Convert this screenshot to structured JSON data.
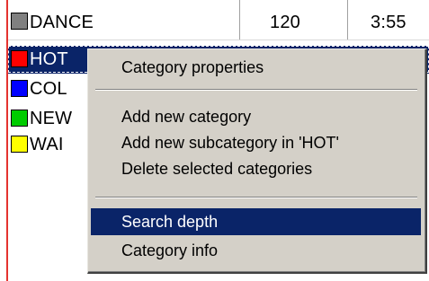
{
  "grid": {
    "rows": [
      {
        "swatch_color": "#808080",
        "name": "DANCE",
        "bpm": "120",
        "length": "3:55"
      },
      {
        "swatch_color": "#ff0000",
        "name": "HOT"
      },
      {
        "swatch_color": "#0000ff",
        "name": "COL"
      },
      {
        "swatch_color": "#00cc00",
        "name": "NEW"
      },
      {
        "swatch_color": "#ffff00",
        "name": "WAI"
      }
    ],
    "selected_index": 1
  },
  "context_menu": {
    "items": [
      {
        "label": "Category properties"
      },
      {
        "label": "Add new category"
      },
      {
        "label": "Add new subcategory in 'HOT'"
      },
      {
        "label": "Delete selected categories"
      },
      {
        "label": "Search depth"
      },
      {
        "label": "Category info"
      }
    ],
    "highlighted_label": "Search depth"
  }
}
